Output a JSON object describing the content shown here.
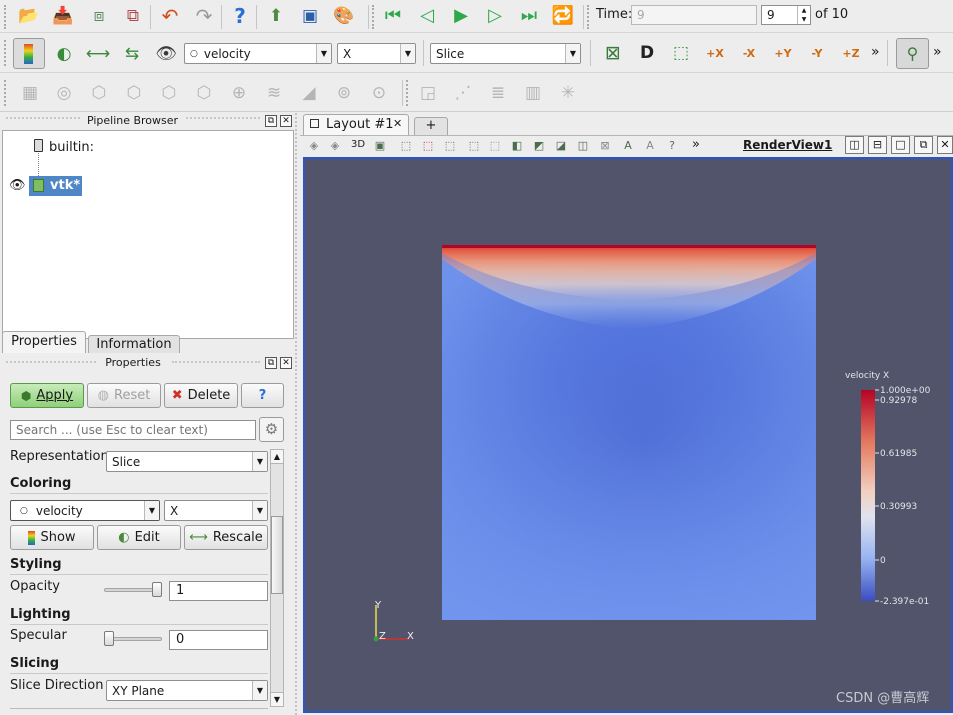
{
  "toolbar1": {
    "time_label": "Time:",
    "time_value_disabled": "9",
    "time_step": "9",
    "time_total": "of 10",
    "icons": [
      "open-icon",
      "recent-files-icon",
      "connect-icon",
      "disconnect-icon",
      "undo-icon",
      "redo-icon",
      "help-icon",
      "save-state-icon",
      "screenshot-icon",
      "color-palette-icon",
      "first-frame-icon",
      "previous-frame-icon",
      "play-icon",
      "next-frame-icon",
      "last-frame-icon",
      "loop-icon"
    ]
  },
  "toolbar2": {
    "color_array": "velocity",
    "component": "X",
    "representation": "Slice",
    "more_glyph": "»"
  },
  "pipeline": {
    "title": "Pipeline Browser",
    "root": "builtin:",
    "source": "vtk*"
  },
  "tabs": {
    "properties": "Properties",
    "information": "Information"
  },
  "properties": {
    "title": "Properties",
    "apply": "Apply",
    "reset": "Reset",
    "delete": "Delete",
    "help": "?",
    "search_placeholder": "Search ... (use Esc to clear text)",
    "representation_label": "Representation",
    "representation_value": "Slice",
    "coloring_header": "Coloring",
    "coloring_array": "velocity",
    "coloring_component": "X",
    "show": "Show",
    "edit": "Edit",
    "rescale": "Rescale",
    "styling_header": "Styling",
    "opacity_label": "Opacity",
    "opacity_value": "1",
    "opacity_level": 1.0,
    "lighting_header": "Lighting",
    "specular_label": "Specular",
    "specular_value": "0",
    "specular_level": 0.0,
    "slicing_header": "Slicing",
    "slice_direction_label": "Slice Direction",
    "slice_direction_value": "XY Plane"
  },
  "layout": {
    "tab_label": "Layout #1",
    "close_glyph": "✕",
    "add_tab": "+",
    "render_view": "RenderView1",
    "view_3d": "3D",
    "more_glyph": "»"
  },
  "render": {
    "legend_title": "velocity X",
    "legend_ticks": [
      "1.000e+00",
      "0.92978",
      "0.61985",
      "0.30993",
      "0",
      "-2.397e-01"
    ],
    "axis_y": "Y",
    "axis_z": "Z",
    "axis_x": "X",
    "watermark": "CSDN @曹高辉",
    "background": "#51546a"
  }
}
